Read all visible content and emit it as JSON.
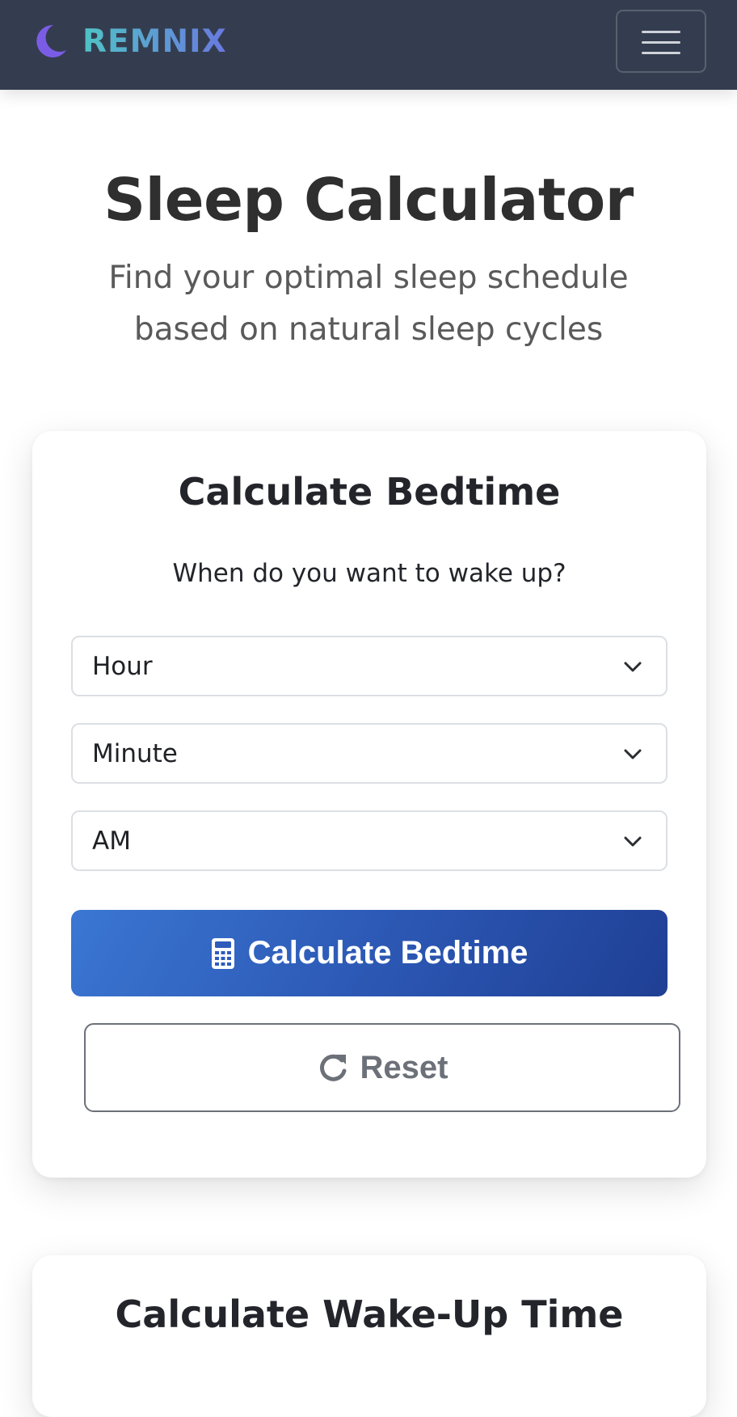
{
  "navbar": {
    "brand_name": "REMNIX",
    "brand_icon": "crescent-moon-icon",
    "menu_icon": "hamburger-menu-icon",
    "brand_gradient": [
      "#4fc3c6",
      "#6a78e0"
    ],
    "background_color": "#343d4f"
  },
  "hero": {
    "title": "Sleep Calculator",
    "subtitle": "Find your optimal sleep schedule based on natural sleep cycles"
  },
  "bedtime_card": {
    "title": "Calculate Bedtime",
    "question": "When do you want to wake up?",
    "hour_select": {
      "selected": "Hour"
    },
    "minute_select": {
      "selected": "Minute"
    },
    "ampm_select": {
      "selected": "AM"
    },
    "calculate_button": {
      "label": "Calculate Bedtime",
      "icon": "calculator-icon"
    },
    "reset_button": {
      "label": "Reset",
      "icon": "redo-icon"
    },
    "accent_color": "#2b56b2"
  },
  "wakeup_card": {
    "title": "Calculate Wake-Up Time"
  }
}
